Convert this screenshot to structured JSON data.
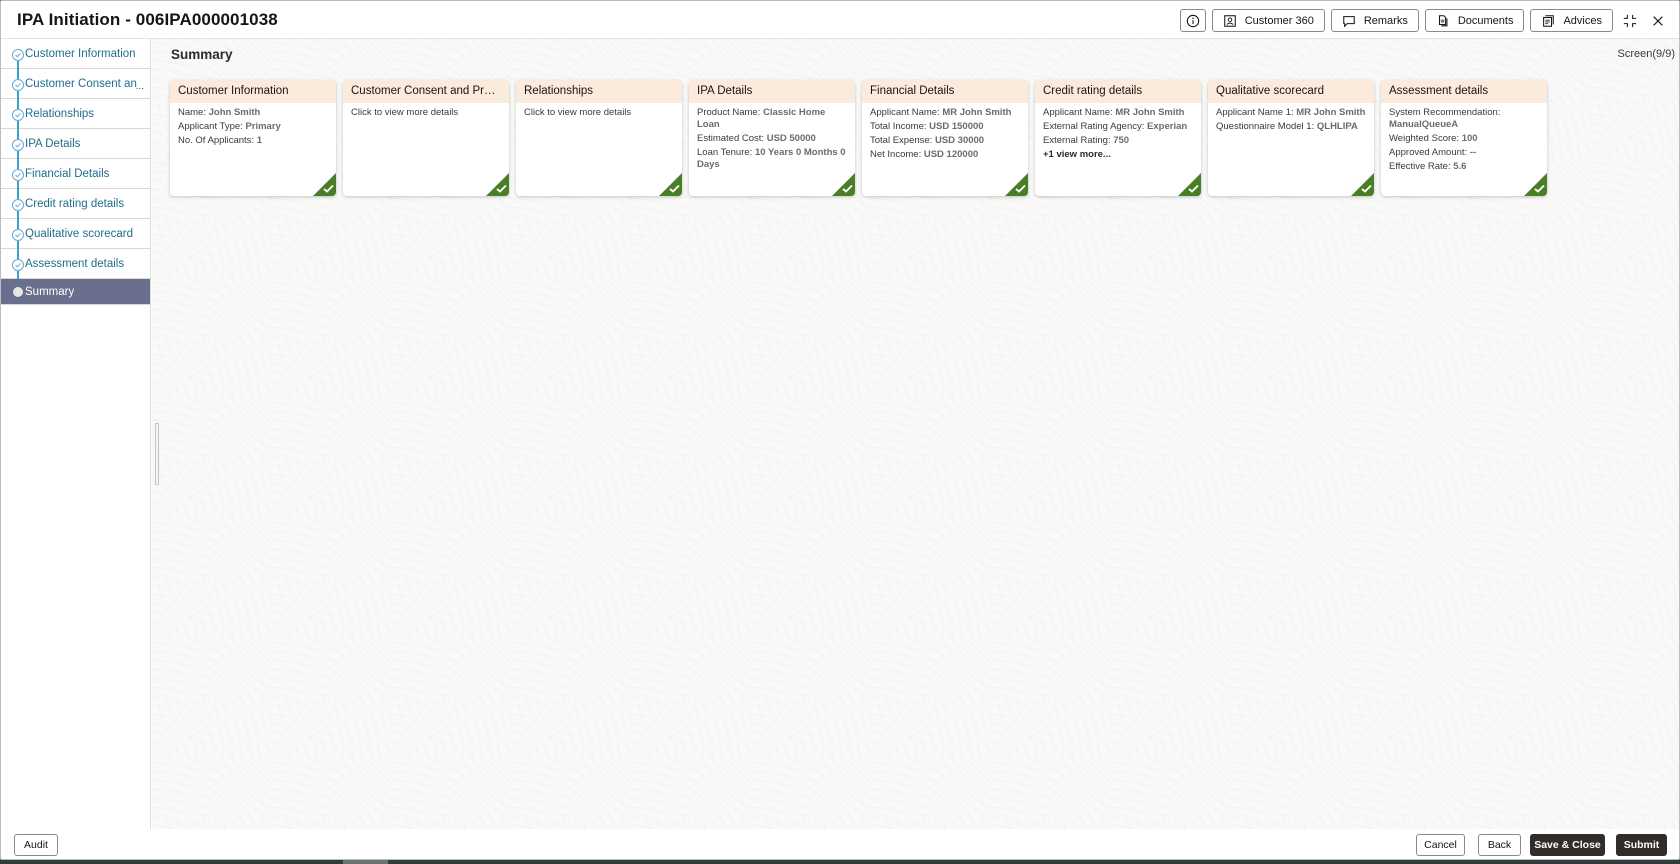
{
  "header": {
    "title": "IPA Initiation - 006IPA000001038",
    "buttons": {
      "info_icon": "info-icon",
      "customer360": "Customer 360",
      "remarks": "Remarks",
      "documents": "Documents",
      "advices": "Advices"
    }
  },
  "sidebar": {
    "items": [
      {
        "label": "Customer Information",
        "status": "completed"
      },
      {
        "label": "Customer Consent and Preferences",
        "display": "Customer Consent and",
        "status": "completed"
      },
      {
        "label": "Relationships",
        "status": "completed"
      },
      {
        "label": "IPA Details",
        "status": "completed"
      },
      {
        "label": "Financial Details",
        "status": "completed"
      },
      {
        "label": "Credit rating details",
        "status": "completed"
      },
      {
        "label": "Qualitative scorecard",
        "status": "completed"
      },
      {
        "label": "Assessment details",
        "status": "completed"
      },
      {
        "label": "Summary",
        "status": "active"
      }
    ],
    "overflow_marker": "..."
  },
  "main": {
    "title": "Summary",
    "screen_counter": "Screen(9/9)",
    "cards": [
      {
        "title": "Customer Information",
        "lines": [
          {
            "k": "Name: ",
            "v": "John Smith"
          },
          {
            "k": "Applicant Type: ",
            "v": "Primary"
          },
          {
            "k": "No. Of Applicants: ",
            "v": "1"
          }
        ]
      },
      {
        "title": "Customer Consent and Pref...",
        "lines": [
          {
            "k": "Click to view more details",
            "v": ""
          }
        ]
      },
      {
        "title": "Relationships",
        "lines": [
          {
            "k": "Click to view more details",
            "v": ""
          }
        ]
      },
      {
        "title": "IPA Details",
        "lines": [
          {
            "k": "Product Name: ",
            "v": "Classic Home Loan"
          },
          {
            "k": "Estimated Cost: ",
            "v": "USD 50000"
          },
          {
            "k": "Loan Tenure: ",
            "v": "10 Years 0 Months 0 Days"
          }
        ]
      },
      {
        "title": "Financial Details",
        "lines": [
          {
            "k": "Applicant Name: ",
            "v": "MR John Smith"
          },
          {
            "k": "Total Income: ",
            "v": "USD 150000"
          },
          {
            "k": "Total Expense: ",
            "v": "USD 30000"
          },
          {
            "k": "Net Income: ",
            "v": "USD 120000"
          }
        ]
      },
      {
        "title": "Credit rating details",
        "lines": [
          {
            "k": "Applicant Name: ",
            "v": "MR John Smith"
          },
          {
            "k": "External Rating Agency: ",
            "v": "Experian"
          },
          {
            "k": "External Rating: ",
            "v": "750"
          }
        ],
        "more": "+1 view more..."
      },
      {
        "title": "Qualitative scorecard",
        "lines": [
          {
            "k": "Applicant Name 1: ",
            "v": "MR John Smith"
          },
          {
            "k": "Questionnaire Model 1: ",
            "v": "QLHLIPA"
          }
        ]
      },
      {
        "title": "Assessment details",
        "lines": [
          {
            "k": "System Recommendation: ",
            "v": "ManualQueueA"
          },
          {
            "k": "Weighted Score: ",
            "v": "100"
          },
          {
            "k": "Approved Amount: ",
            "v": "--"
          },
          {
            "k": "Effective Rate: ",
            "v": "5.6"
          }
        ]
      }
    ]
  },
  "footer": {
    "audit": "Audit",
    "cancel": "Cancel",
    "back": "Back",
    "save_close": "Save & Close",
    "submit": "Submit"
  },
  "colors": {
    "card_header": "#fbebdc",
    "complete_badge": "#4a7d27",
    "nav_active": "#6a6f8e",
    "nav_link": "#1f6d8a",
    "primary_button": "#312d2a"
  }
}
